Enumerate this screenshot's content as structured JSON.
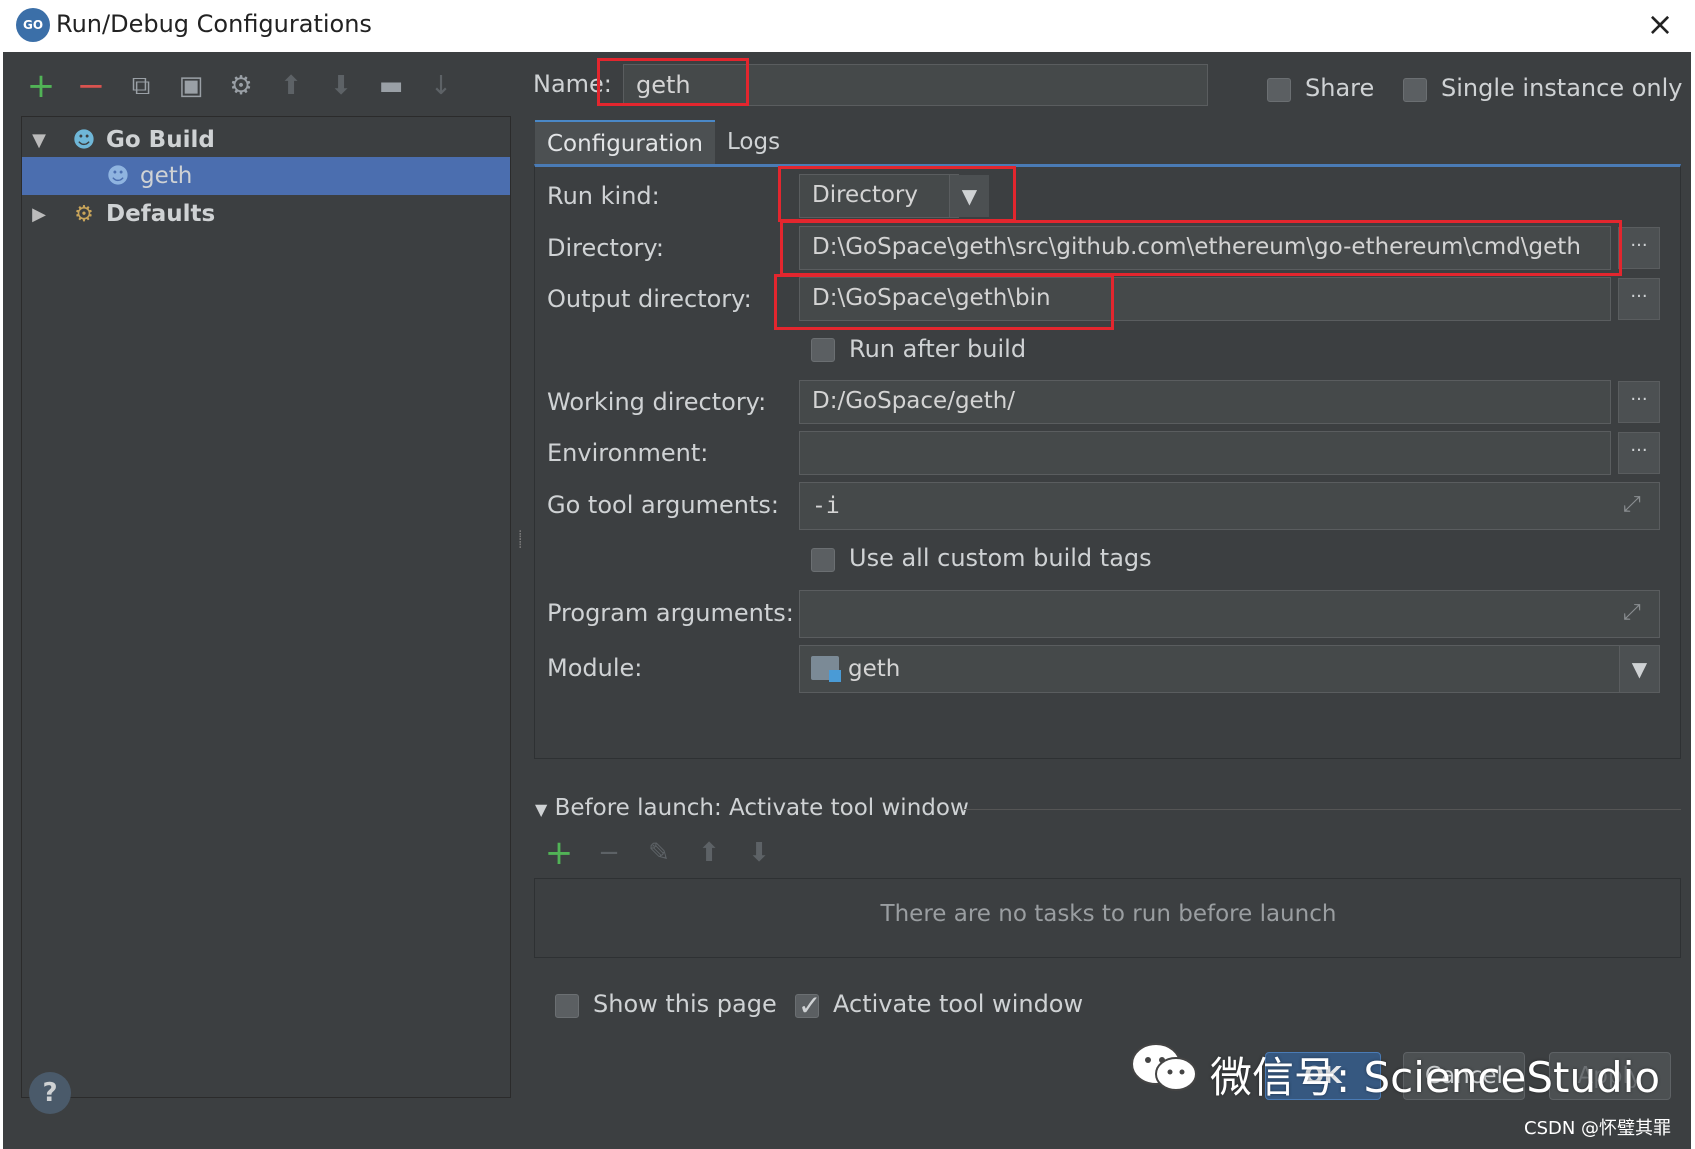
{
  "window": {
    "title": "Run/Debug Configurations",
    "app_icon_text": "GO",
    "close_glyph": "×"
  },
  "left_toolbar": {
    "icons": [
      "add-icon",
      "remove-icon",
      "copy-icon",
      "save-icon",
      "wrench-icon",
      "move-up-icon",
      "move-down-icon",
      "folder-icon",
      "sort-icon"
    ]
  },
  "tree": {
    "go_build": "Go Build",
    "geth": "geth",
    "defaults": "Defaults"
  },
  "header": {
    "name_label": "Name:",
    "name_value": "geth",
    "share_label": "Share",
    "single_instance_label": "Single instance only"
  },
  "tabs": [
    {
      "label": "Configuration",
      "active": true
    },
    {
      "label": "Logs",
      "active": false
    }
  ],
  "config": {
    "run_kind_label": "Run kind:",
    "run_kind_value": "Directory",
    "directory_label": "Directory:",
    "directory_value": "D:\\GoSpace\\geth\\src\\github.com\\ethereum\\go-ethereum\\cmd\\geth",
    "output_dir_label": "Output directory:",
    "output_dir_value": "D:\\GoSpace\\geth\\bin",
    "run_after_build_label": "Run after build",
    "working_dir_label": "Working directory:",
    "working_dir_value": "D:/GoSpace/geth/",
    "environment_label": "Environment:",
    "environment_value": "",
    "go_tool_args_label": "Go tool arguments:",
    "go_tool_args_value": "-i",
    "custom_build_tags_label": "Use all custom build tags",
    "program_args_label": "Program arguments:",
    "program_args_value": "",
    "module_label": "Module:",
    "module_value": "geth",
    "browse_glyph": "···"
  },
  "before_launch": {
    "title": "Before launch: Activate tool window",
    "empty_text": "There are no tasks to run before launch",
    "show_page_label": "Show this page",
    "activate_label": "Activate tool window"
  },
  "buttons": {
    "ok": "OK",
    "cancel": "Cancel",
    "apply": "Apply",
    "help": "?"
  },
  "watermark": {
    "text": "微信号: ScienceStudio",
    "csdn": "CSDN @怀璧其罪"
  },
  "colors": {
    "dialog_bg": "#3c3f41",
    "selection": "#4b6eaf",
    "highlight_box": "#e3262e",
    "add_green": "#51b356",
    "remove_red": "#d9534f"
  }
}
